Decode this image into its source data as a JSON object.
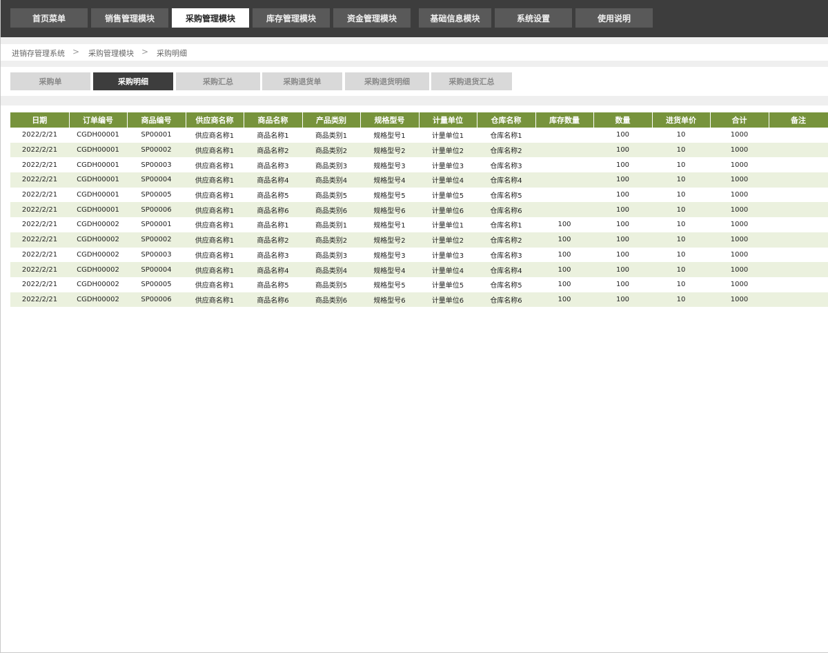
{
  "top_nav": [
    {
      "label": "首页菜单",
      "active": false
    },
    {
      "label": "销售管理模块",
      "active": false
    },
    {
      "label": "采购管理模块",
      "active": true
    },
    {
      "label": "库存管理模块",
      "active": false
    },
    {
      "label": "资金管理模块",
      "active": false
    },
    {
      "label": "基础信息模块",
      "active": false
    },
    {
      "label": "系统设置",
      "active": false
    },
    {
      "label": "使用说明",
      "active": false
    }
  ],
  "breadcrumb": [
    "进销存管理系统",
    "采购管理模块",
    "采购明细"
  ],
  "breadcrumb_separator": ">",
  "sub_tabs": [
    {
      "label": "采购单",
      "active": false
    },
    {
      "label": "采购明细",
      "active": true
    },
    {
      "label": "采购汇总",
      "active": false
    },
    {
      "label": "采购退货单",
      "active": false
    },
    {
      "label": "采购退货明细",
      "active": false
    },
    {
      "label": "采购退货汇总",
      "active": false
    }
  ],
  "table": {
    "columns": [
      "日期",
      "订单编号",
      "商品编号",
      "供应商名称",
      "商品名称",
      "产品类别",
      "规格型号",
      "计量单位",
      "仓库名称",
      "库存数量",
      "数量",
      "进货单价",
      "合计",
      "备注"
    ],
    "rows": [
      [
        "2022/2/21",
        "CGDH00001",
        "SP00001",
        "供应商名称1",
        "商品名称1",
        "商品类别1",
        "规格型号1",
        "计量单位1",
        "仓库名称1",
        "",
        "100",
        "10",
        "1000",
        ""
      ],
      [
        "2022/2/21",
        "CGDH00001",
        "SP00002",
        "供应商名称1",
        "商品名称2",
        "商品类别2",
        "规格型号2",
        "计量单位2",
        "仓库名称2",
        "",
        "100",
        "10",
        "1000",
        ""
      ],
      [
        "2022/2/21",
        "CGDH00001",
        "SP00003",
        "供应商名称1",
        "商品名称3",
        "商品类别3",
        "规格型号3",
        "计量单位3",
        "仓库名称3",
        "",
        "100",
        "10",
        "1000",
        ""
      ],
      [
        "2022/2/21",
        "CGDH00001",
        "SP00004",
        "供应商名称1",
        "商品名称4",
        "商品类别4",
        "规格型号4",
        "计量单位4",
        "仓库名称4",
        "",
        "100",
        "10",
        "1000",
        ""
      ],
      [
        "2022/2/21",
        "CGDH00001",
        "SP00005",
        "供应商名称1",
        "商品名称5",
        "商品类别5",
        "规格型号5",
        "计量单位5",
        "仓库名称5",
        "",
        "100",
        "10",
        "1000",
        ""
      ],
      [
        "2022/2/21",
        "CGDH00001",
        "SP00006",
        "供应商名称1",
        "商品名称6",
        "商品类别6",
        "规格型号6",
        "计量单位6",
        "仓库名称6",
        "",
        "100",
        "10",
        "1000",
        ""
      ],
      [
        "2022/2/21",
        "CGDH00002",
        "SP00001",
        "供应商名称1",
        "商品名称1",
        "商品类别1",
        "规格型号1",
        "计量单位1",
        "仓库名称1",
        "100",
        "100",
        "10",
        "1000",
        ""
      ],
      [
        "2022/2/21",
        "CGDH00002",
        "SP00002",
        "供应商名称1",
        "商品名称2",
        "商品类别2",
        "规格型号2",
        "计量单位2",
        "仓库名称2",
        "100",
        "100",
        "10",
        "1000",
        ""
      ],
      [
        "2022/2/21",
        "CGDH00002",
        "SP00003",
        "供应商名称1",
        "商品名称3",
        "商品类别3",
        "规格型号3",
        "计量单位3",
        "仓库名称3",
        "100",
        "100",
        "10",
        "1000",
        ""
      ],
      [
        "2022/2/21",
        "CGDH00002",
        "SP00004",
        "供应商名称1",
        "商品名称4",
        "商品类别4",
        "规格型号4",
        "计量单位4",
        "仓库名称4",
        "100",
        "100",
        "10",
        "1000",
        ""
      ],
      [
        "2022/2/21",
        "CGDH00002",
        "SP00005",
        "供应商名称1",
        "商品名称5",
        "商品类别5",
        "规格型号5",
        "计量单位5",
        "仓库名称5",
        "100",
        "100",
        "10",
        "1000",
        ""
      ],
      [
        "2022/2/21",
        "CGDH00002",
        "SP00006",
        "供应商名称1",
        "商品名称6",
        "商品类别6",
        "规格型号6",
        "计量单位6",
        "仓库名称6",
        "100",
        "100",
        "10",
        "1000",
        ""
      ]
    ]
  },
  "colors": {
    "top_bar": "#3d3d3d",
    "nav_button": "#595959",
    "header_green": "#77933c",
    "row_alt": "#ebf1de",
    "subtab_active": "#3d3d3d",
    "subtab_inactive": "#d9d9d9"
  }
}
